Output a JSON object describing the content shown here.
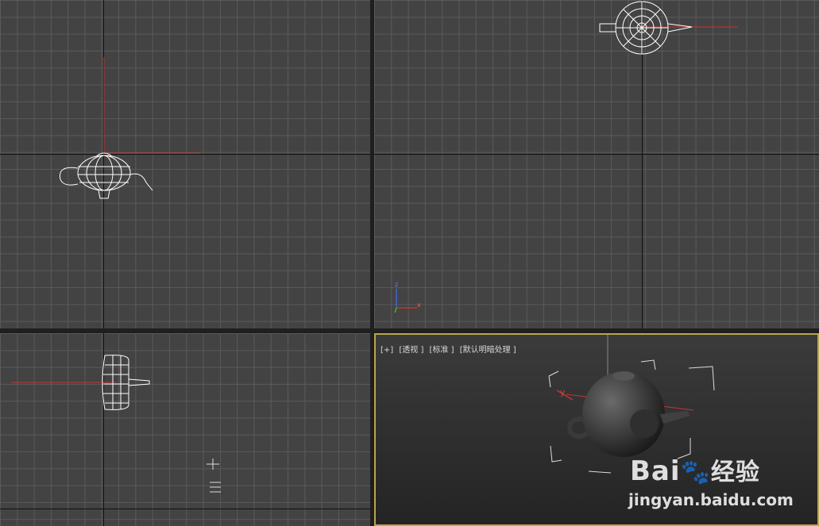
{
  "viewports": {
    "top": {},
    "front": {},
    "left": {},
    "perspective": {
      "label_plus": "[+]",
      "label_view": "[透视 ]",
      "label_shading": "[标准 ]",
      "label_lighting": "[默认明暗处理 ]"
    }
  },
  "gizmo": {
    "x_label": "x",
    "y_label": "y",
    "z_label": "z"
  },
  "watermark": {
    "brand": "Bai",
    "brand_suffix": "经验",
    "url": "jingyan.baidu.com"
  },
  "colors": {
    "selected_border": "#b8a64a",
    "axis_red": "#c83232",
    "axis_green": "#3cb43c",
    "axis_blue": "#3c64dc"
  }
}
